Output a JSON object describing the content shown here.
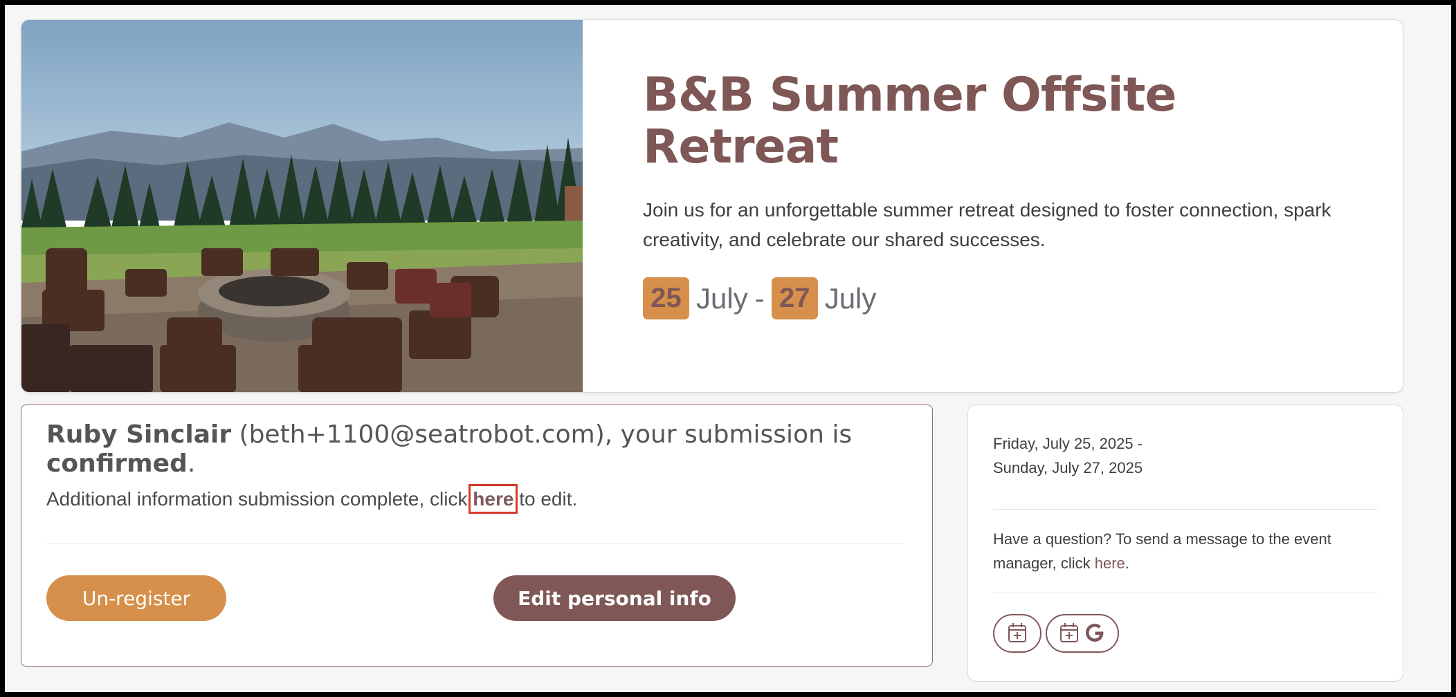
{
  "event": {
    "title": "B&B Summer Offsite Retreat",
    "description": "Join us for an unforgettable summer retreat designed to foster connection, spark creativity, and celebrate our shared successes.",
    "start_day": "25",
    "start_month": "July",
    "separator": "-",
    "end_day": "27",
    "end_month": "July",
    "image_icon": "photo-campfire-chairs-mountains"
  },
  "confirmation": {
    "name": "Ruby Sinclair",
    "email_text": " (beth+1100@seatrobot.com), your submission is ",
    "status": "confirmed",
    "period": ".",
    "info_prefix": "Additional information submission complete, click ",
    "info_link": "here",
    "info_suffix": " to edit.",
    "unregister_label": "Un-register",
    "edit_label": "Edit personal info"
  },
  "side": {
    "date_line1": "Friday, July 25, 2025 -",
    "date_line2": "Sunday, July 27, 2025",
    "question_prefix": "Have a question? To send a message to the event manager, click ",
    "question_link": "here",
    "question_suffix": ".",
    "calendar_icon": "calendar-add-icon",
    "google_icon": "google-g-icon"
  },
  "colors": {
    "brand": "#7f5757",
    "accent": "#d6904b",
    "highlight": "#d63a2a"
  }
}
